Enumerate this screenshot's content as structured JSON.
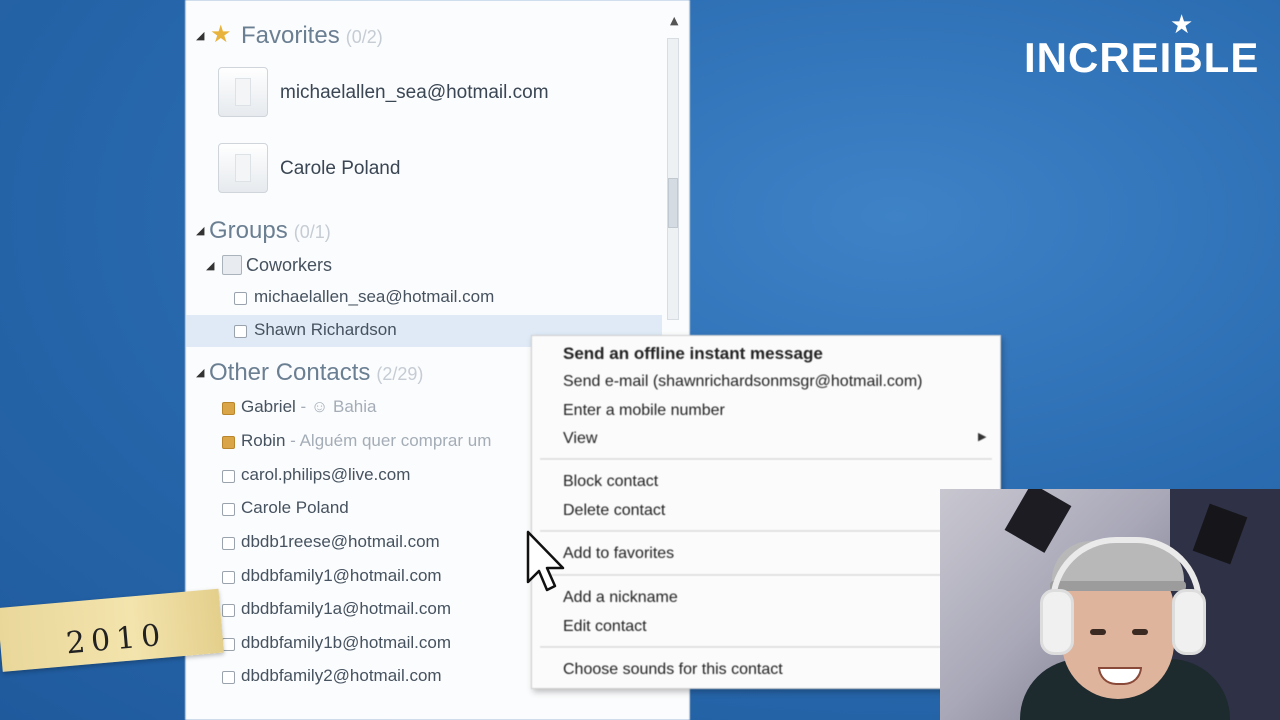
{
  "brand": {
    "name": "INCREIBLE"
  },
  "year_tape": {
    "text": "2010"
  },
  "contacts": {
    "favorites": {
      "title": "Favorites",
      "count": "(0/2)",
      "items": [
        {
          "name": "michaelallen_sea@hotmail.com"
        },
        {
          "name": "Carole Poland"
        }
      ]
    },
    "groups": {
      "title": "Groups",
      "count": "(0/1)",
      "group_name": "Coworkers",
      "items": [
        {
          "name": "michaelallen_sea@hotmail.com"
        },
        {
          "name": "Shawn Richardson"
        }
      ]
    },
    "other": {
      "title": "Other Contacts",
      "count": "(2/29)",
      "items": [
        {
          "name": "Gabriel",
          "sub": " - ☺ Bahia",
          "status": "away"
        },
        {
          "name": "Robin",
          "sub": " - Alguém quer comprar um",
          "status": "away"
        },
        {
          "name": "carol.philips@live.com",
          "status": "offline"
        },
        {
          "name": "Carole Poland",
          "status": "offline"
        },
        {
          "name": "dbdb1reese@hotmail.com",
          "status": "offline"
        },
        {
          "name": "dbdbfamily1@hotmail.com",
          "status": "offline"
        },
        {
          "name": "dbdbfamily1a@hotmail.com",
          "status": "offline"
        },
        {
          "name": "dbdbfamily1b@hotmail.com",
          "status": "offline"
        },
        {
          "name": "dbdbfamily2@hotmail.com",
          "status": "offline"
        }
      ]
    }
  },
  "context_menu": {
    "items": [
      {
        "label": "Send an offline instant message"
      },
      {
        "label": "Send e-mail (shawnrichardsonmsgr@hotmail.com)"
      },
      {
        "label": "Enter a mobile number"
      },
      {
        "label": "View"
      },
      {
        "label": "Block contact"
      },
      {
        "label": "Delete contact"
      },
      {
        "label": "Add to favorites"
      },
      {
        "label": "Add a nickname"
      },
      {
        "label": "Edit contact"
      },
      {
        "label": "Choose sounds for this contact"
      }
    ]
  },
  "colors": {
    "accent_blue": "#2a6bb0",
    "away_status": "#d9a546"
  }
}
